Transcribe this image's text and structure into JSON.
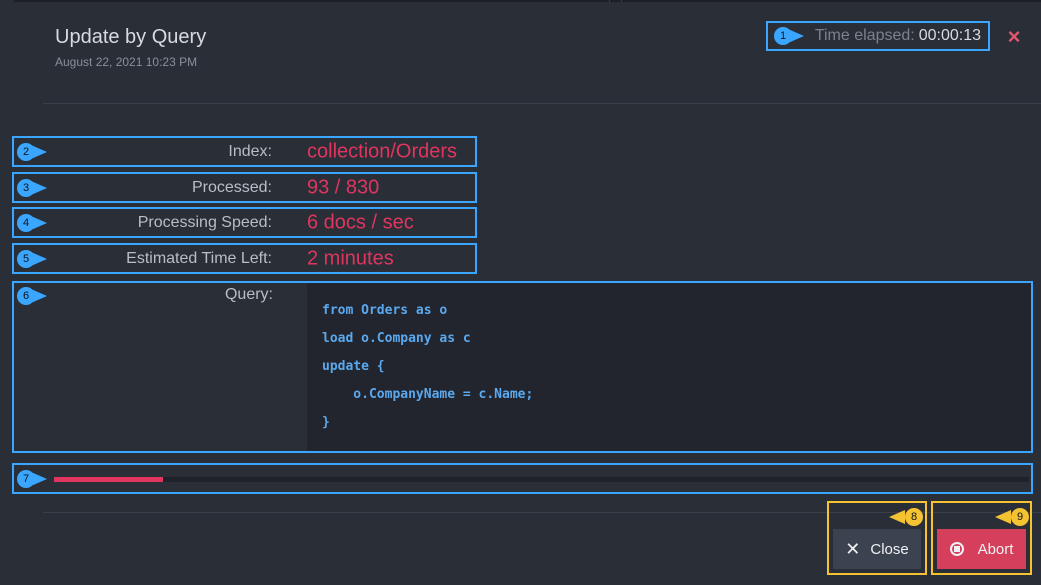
{
  "dialog": {
    "title": "Update by Query",
    "date": "August 22, 2021 10:23 PM",
    "elapsed_label": "Time elapsed:",
    "elapsed_value": "00:00:13",
    "close_icon": "×"
  },
  "details": {
    "index": {
      "label": "Index:",
      "value": "collection/Orders"
    },
    "processed": {
      "label": "Processed:",
      "value": "93 / 830"
    },
    "speed": {
      "label": "Processing Speed:",
      "value": "6 docs / sec"
    },
    "time_left": {
      "label": "Estimated Time Left:",
      "value": "2 minutes"
    },
    "query": {
      "label": "Query:",
      "lines": [
        "from Orders as o",
        "load o.Company as c",
        "update {",
        "    o.CompanyName = c.Name;",
        "}"
      ]
    }
  },
  "progress": {
    "fraction": 0.112,
    "color": "#e0355e"
  },
  "callouts": [
    "1",
    "2",
    "3",
    "4",
    "5",
    "6",
    "7",
    "8",
    "9"
  ],
  "buttons": {
    "close_label": "Close",
    "close_icon": "x-icon",
    "abort_label": "Abort",
    "abort_icon": "stop-icon"
  },
  "colors": {
    "accent_red": "#e0355e",
    "highlight_blue": "#3aa6ff",
    "highlight_yellow": "#f5c331"
  }
}
